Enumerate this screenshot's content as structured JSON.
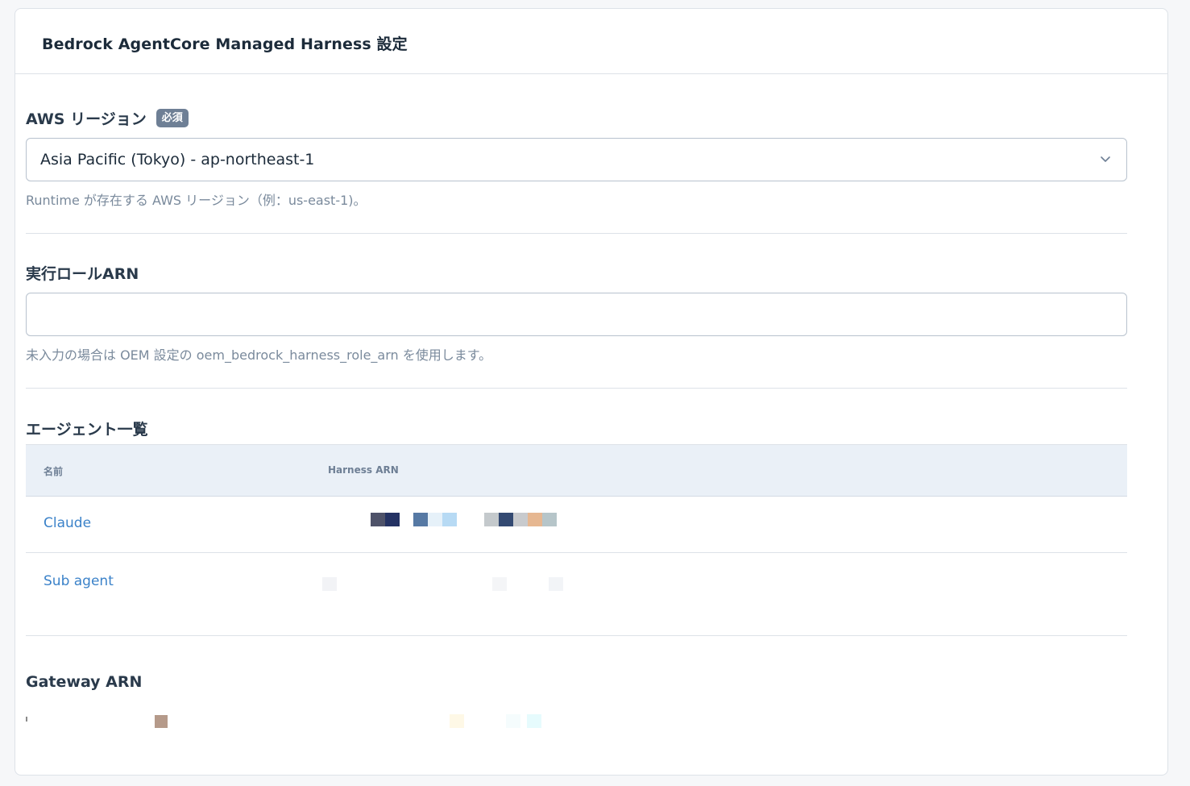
{
  "card": {
    "title": "Bedrock AgentCore Managed Harness 設定"
  },
  "region": {
    "label": "AWS リージョン",
    "required_badge": "必須",
    "selected_value": "Asia Pacific (Tokyo) - ap-northeast-1",
    "help": "Runtime が存在する AWS リージョン（例：us-east-1)。"
  },
  "role": {
    "label": "実行ロールARN",
    "value": "",
    "help": "未入力の場合は OEM 設定の oem_bedrock_harness_role_arn を使用します。"
  },
  "agents": {
    "heading": "エージェント一覧",
    "columns": [
      "名前",
      "Harness ARN"
    ],
    "rows": [
      {
        "name": "Claude",
        "arn_masked": true
      },
      {
        "name": "Sub agent",
        "arn_masked": true
      }
    ]
  },
  "gateway": {
    "label": "Gateway ARN",
    "arn_masked": true
  },
  "colors": {
    "link": "#3b82c9",
    "badge": "#6e7f95",
    "table_header_bg": "#eaf0f7"
  }
}
